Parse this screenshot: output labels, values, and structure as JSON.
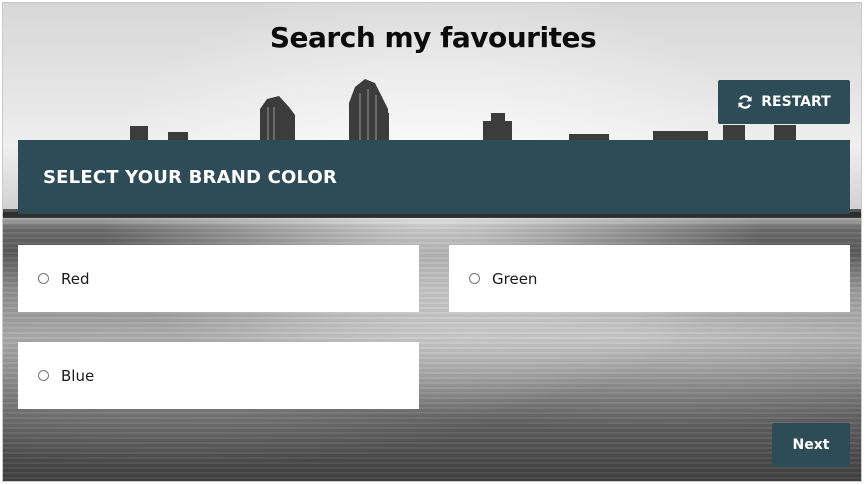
{
  "page": {
    "title": "Search my favourites"
  },
  "toolbar": {
    "restart_label": "RESTART",
    "restart_icon": "refresh-icon"
  },
  "question": {
    "text": "SELECT YOUR BRAND COLOR",
    "options": [
      {
        "label": "Red",
        "selected": false
      },
      {
        "label": "Green",
        "selected": false
      },
      {
        "label": "Blue",
        "selected": false
      }
    ]
  },
  "navigation": {
    "next_label": "Next"
  },
  "colors": {
    "accent": "#2e4c58",
    "option_background": "#ffffff",
    "title_text": "#0b0b0b"
  }
}
